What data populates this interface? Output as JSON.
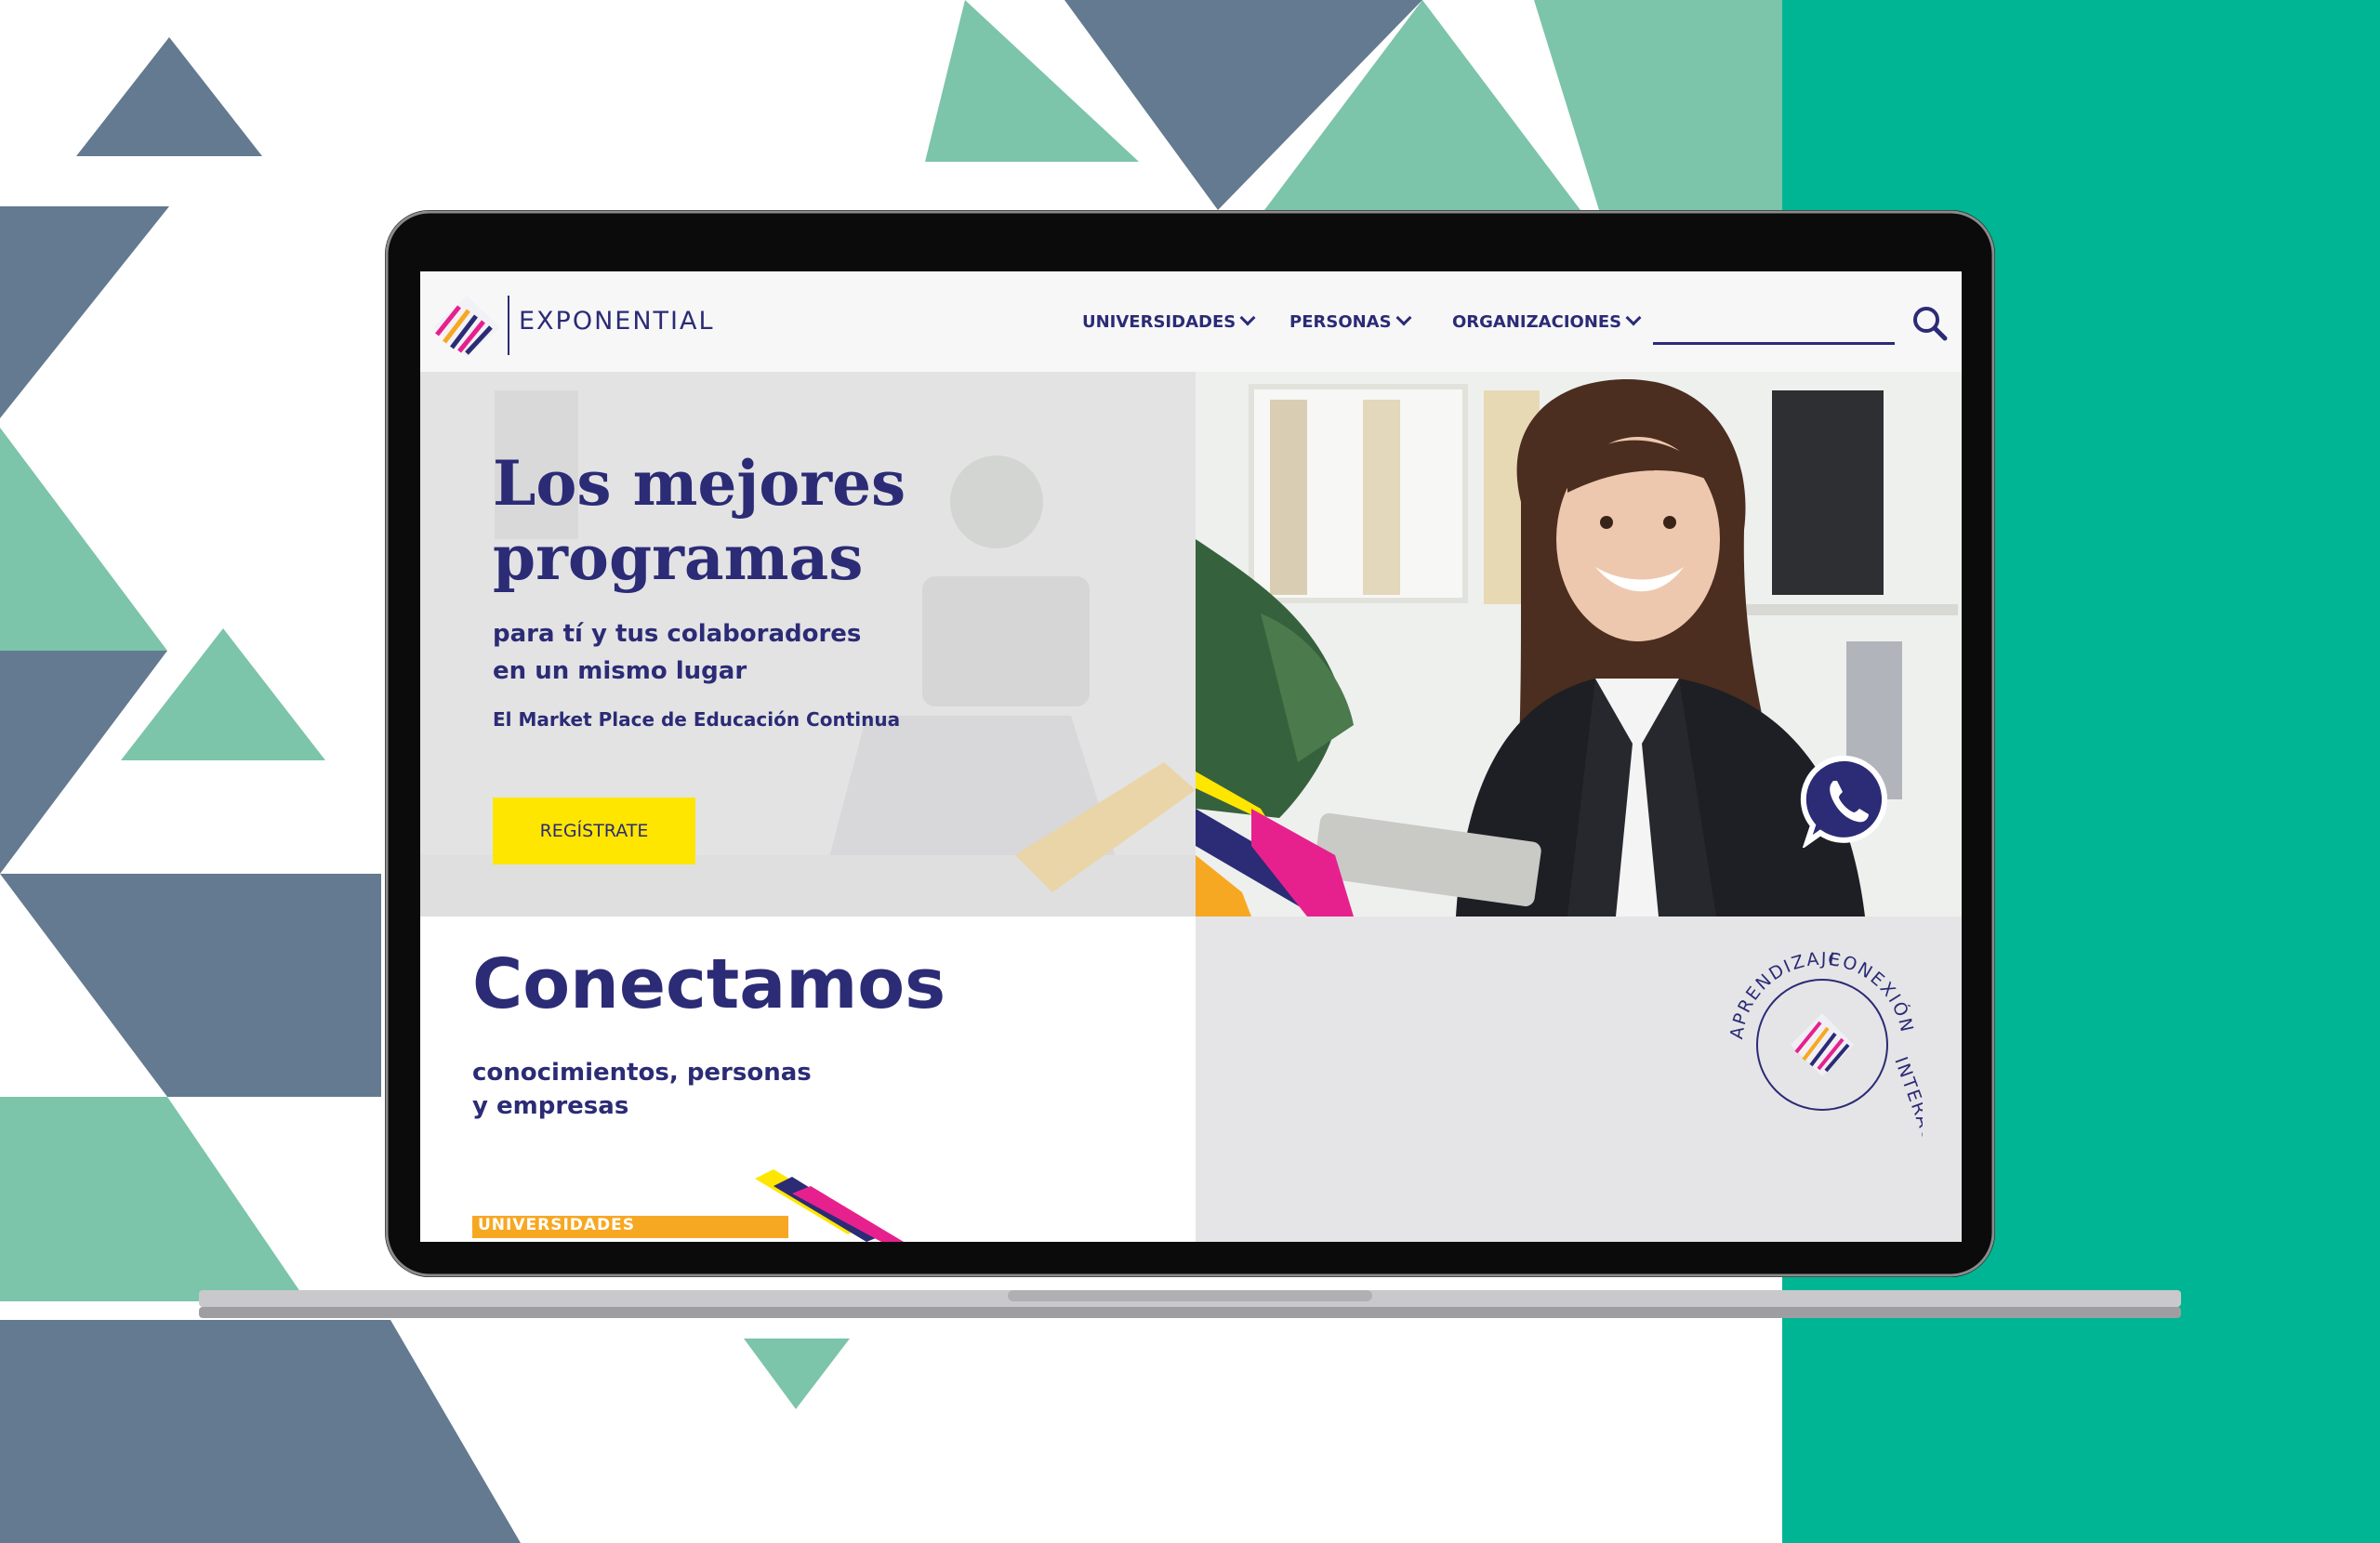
{
  "brand": {
    "name": "EXPONENTIAL",
    "logo_icon": "exponential-logo-icon"
  },
  "nav": {
    "items": [
      {
        "label": "UNIVERSIDADES",
        "icon": "chevron-down-icon"
      },
      {
        "label": "PERSONAS",
        "icon": "chevron-down-icon"
      },
      {
        "label": "ORGANIZACIONES",
        "icon": "chevron-down-icon"
      }
    ],
    "search": {
      "value": "",
      "placeholder": "",
      "icon": "search-icon"
    }
  },
  "hero": {
    "title_line1": "Los mejores",
    "title_line2": "programas",
    "subtitle_line1": "para tí y tus colaboradores",
    "subtitle_line2": "en un mismo lugar",
    "tagline": "El Market Place de Educación Continua",
    "cta_label": "REGÍSTRATE",
    "whatsapp_icon": "whatsapp-icon"
  },
  "section": {
    "title": "Conectamos",
    "subtitle_line1": "conocimientos, personas",
    "subtitle_line2": "y empresas",
    "category_label": "UNIVERSIDADES"
  },
  "badge": {
    "word_top": "CONEXIÓN",
    "word_right": "INTERACCIÓN",
    "word_left": "APRENDIZAJE"
  },
  "colors": {
    "brand_navy": "#2b2b76",
    "cta_yellow": "#ffe600",
    "teal": "#00b594",
    "slate": "#637a90",
    "mint": "#7cc4aa"
  }
}
